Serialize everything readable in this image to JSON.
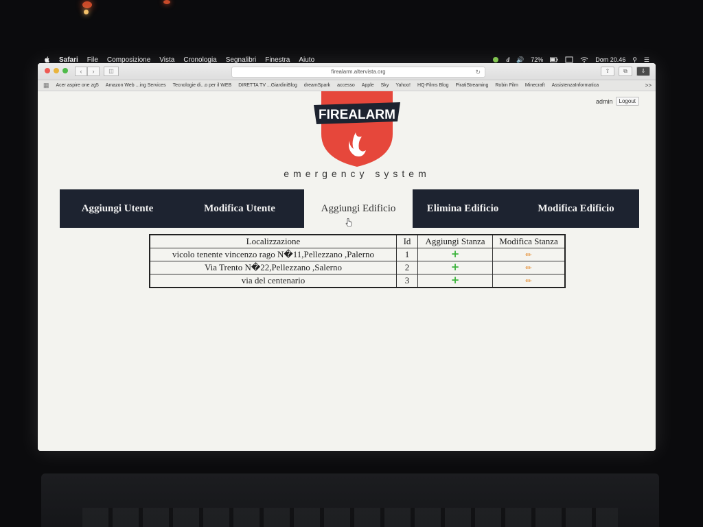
{
  "menubar": {
    "items": [
      "Safari",
      "File",
      "Composizione",
      "Vista",
      "Cronologia",
      "Segnalibri",
      "Finestra",
      "Aiuto"
    ],
    "battery": "72%",
    "clock": "Dom 20.46"
  },
  "browser": {
    "url": "firealarm.altervista.org",
    "bookmarks": [
      "Acer aspire one zg5",
      "Amazon Web ...ing Services",
      "Tecnologie di...o per il WEB",
      "DIRETTA TV ...GiardiniBlog",
      "dreamSpark",
      "accesso",
      "Apple",
      "Sky",
      "Yahoo!",
      "HQ-Films Blog",
      "PiratiStreaming",
      "Robin Film",
      "Minecraft",
      "AssistenzaInformatica"
    ],
    "more": ">>"
  },
  "user": {
    "name": "admin",
    "logout_label": "Logout"
  },
  "logo": {
    "text": "FIREALARM",
    "tagline": "emergency system",
    "shield_color": "#e6473b",
    "banner_color": "#1d2330"
  },
  "nav": {
    "tabs": [
      {
        "label": "Aggiungi Utente"
      },
      {
        "label": "Modifica Utente"
      },
      {
        "label": "Aggiungi Edificio",
        "active": true
      },
      {
        "label": "Elimina Edificio"
      },
      {
        "label": "Modifica Edificio"
      }
    ]
  },
  "table": {
    "headers": [
      "Localizzazione",
      "Id",
      "Aggiungi Stanza",
      "Modifica Stanza"
    ],
    "rows": [
      {
        "location": "vicolo tenente vincenzo rago N�11,Pellezzano ,Palerno",
        "id": "1"
      },
      {
        "location": "Via Trento N�22,Pellezzano ,Salerno",
        "id": "2"
      },
      {
        "location": "via del centenario",
        "id": "3"
      }
    ],
    "add_icon": "plus-icon",
    "edit_icon": "pencil-icon"
  }
}
